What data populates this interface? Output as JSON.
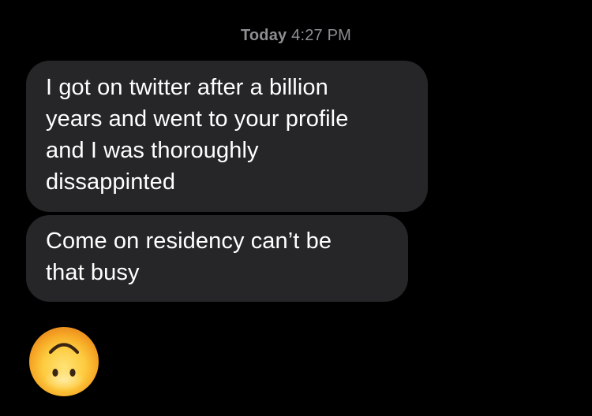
{
  "conversation": {
    "timestamp": {
      "day": "Today",
      "time": "4:27 PM"
    },
    "messages": [
      {
        "lines": [
          "I got on twitter after a billion",
          "years and went to your profile",
          "and I was thoroughly",
          "dissappinted"
        ]
      },
      {
        "lines": [
          "Come on residency can’t be",
          "that busy"
        ]
      }
    ],
    "emoji": {
      "icon": "upside-down-face-emoji"
    }
  },
  "colors": {
    "background": "#000000",
    "bubble": "#262628",
    "timestamp": "#8e8e93",
    "text": "#ffffff"
  }
}
